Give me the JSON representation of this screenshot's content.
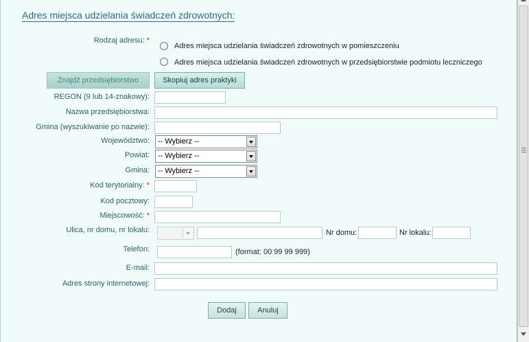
{
  "form": {
    "title": "Adres miejsca udzielania świadczeń zdrowotnych:",
    "address_type": {
      "label": "Rodzaj adresu:",
      "required_mark": "*",
      "options": [
        {
          "label": "Adres miejsca udzielania świadczeń zdrowotnych w pomieszczeniu",
          "checked": false
        },
        {
          "label": "Adres miejsca udzielania świadczeń zdrowotnych w przedsiębiorstwie podmiotu leczniczego",
          "checked": false
        }
      ]
    },
    "buttons": {
      "find_company": "Znajdź przedsiębiorstwo",
      "copy_address": "Skopiuj adres praktyki",
      "add": "Dodaj",
      "cancel": "Anuluj"
    },
    "fields": {
      "regon": {
        "label": "REGON (9 lub 14-znakowy):",
        "value": ""
      },
      "company_name": {
        "label": "Nazwa przedsiębiorstwa:",
        "value": ""
      },
      "commune_search": {
        "label": "Gmina (wyszukiwanie po nazwie):",
        "value": ""
      },
      "voivodeship": {
        "label": "Województwo:",
        "selected": "-- Wybierz --"
      },
      "county": {
        "label": "Powiat:",
        "selected": "-- Wybierz --"
      },
      "commune": {
        "label": "Gmina:",
        "selected": "-- Wybierz --"
      },
      "territorial_code": {
        "label": "Kod terytorialny:",
        "required_mark": "*",
        "value": ""
      },
      "postal_code": {
        "label": "Kod pocztowy:",
        "value": ""
      },
      "city": {
        "label": "Miejscowość:",
        "required_mark": "*",
        "value": ""
      },
      "street": {
        "label": "Ulica, nr domu, nr lokalu:",
        "street_prefix": "",
        "street_value": "",
        "house_no_label": "Nr domu:",
        "house_no_value": "",
        "unit_no_label": "Nr lokalu:",
        "unit_no_value": ""
      },
      "phone": {
        "label": "Telefon:",
        "value": "",
        "hint": "(format: 00 99 99 999)"
      },
      "email": {
        "label": "E-mail:",
        "value": ""
      },
      "website": {
        "label": "Adres strony internetowej:",
        "value": ""
      }
    }
  },
  "colors": {
    "panel_bg": "#f1fbf9",
    "title": "#2a6a86",
    "label": "#2e5f6e",
    "required": "#cc2222",
    "button_bg": "#c5e3de"
  },
  "icons": {
    "select_arrow": "chevron-down-icon",
    "scroll_up": "arrow-up-icon",
    "scroll_down": "arrow-down-icon"
  }
}
